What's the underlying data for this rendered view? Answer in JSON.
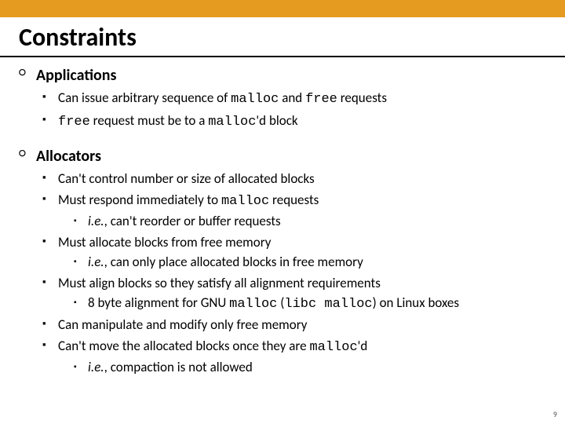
{
  "title": "Constraints",
  "pagenum": "9",
  "sections": [
    {
      "heading": "Applications",
      "items": [
        {
          "before": "Can issue arbitrary sequence of ",
          "code1": "malloc",
          "mid": " and ",
          "code2": "free",
          "after": " requests"
        },
        {
          "code1": "free",
          "mid": " request must be to a ",
          "code2": "malloc",
          "after": "'d  block"
        }
      ]
    },
    {
      "heading": "Allocators",
      "items": [
        {
          "before": "Can't control number or size of allocated blocks"
        },
        {
          "before": "Must respond immediately to ",
          "code1": "malloc",
          "after": " requests",
          "sub": {
            "ital": "i.e.",
            "rest": ", can't reorder or buffer requests"
          }
        },
        {
          "before": "Must allocate blocks from free memory",
          "sub": {
            "ital": "i.e.",
            "rest": ", can only place allocated blocks in free memory"
          }
        },
        {
          "before": "Must align blocks so they satisfy all alignment requirements",
          "sub": {
            "rest_before": "8 byte alignment for GNU ",
            "code1": "malloc",
            "rest_mid": " (",
            "code2": "libc malloc",
            "rest_after": ") on Linux boxes"
          }
        },
        {
          "before": "Can manipulate and modify only free memory"
        },
        {
          "before": "Can't move the allocated blocks once they are ",
          "code1": "malloc",
          "after": "'d",
          "sub": {
            "ital": "i.e.",
            "rest": ", compaction is not allowed"
          }
        }
      ]
    }
  ]
}
